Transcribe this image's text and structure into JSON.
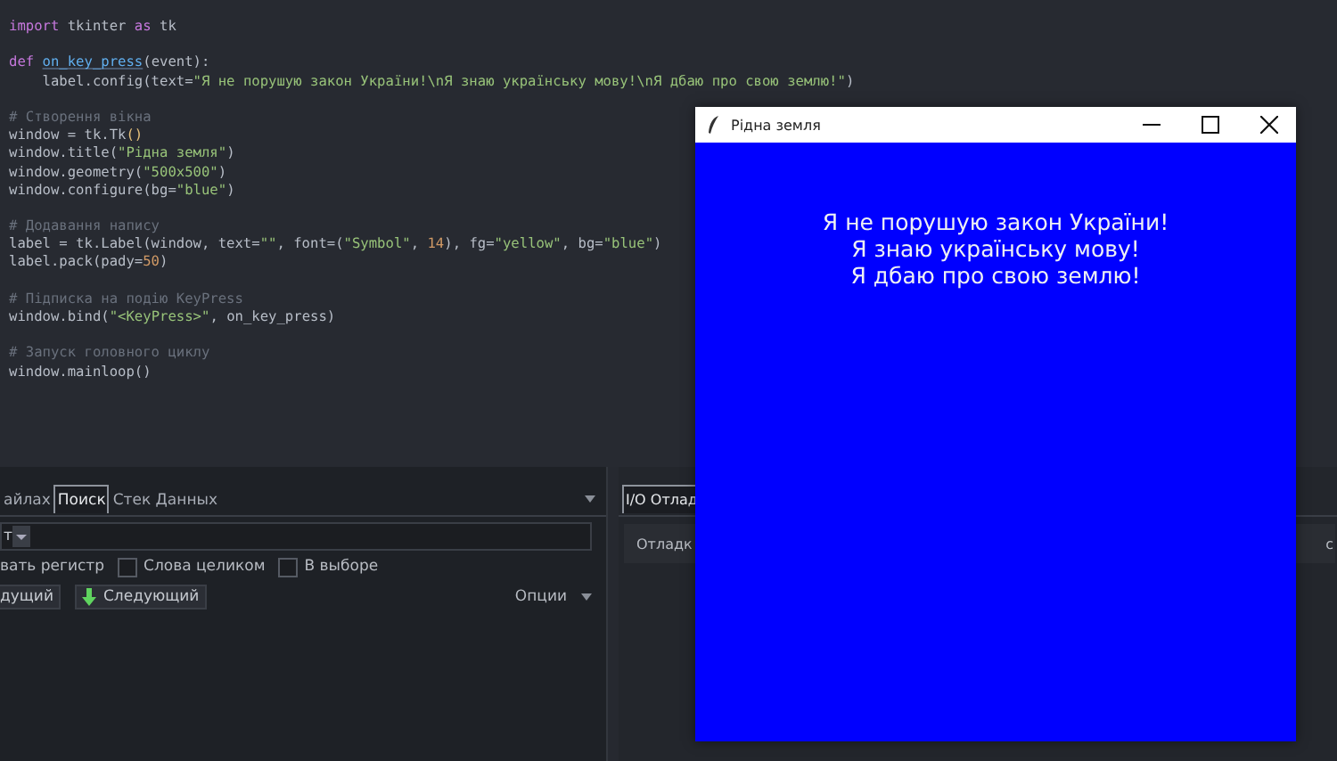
{
  "editor": {
    "lines": [
      {
        "gap_before": false,
        "tokens": [
          {
            "t": "import",
            "kind": "kw"
          },
          {
            "t": " tkinter ",
            "kind": "plain"
          },
          {
            "t": "as",
            "kind": "kw"
          },
          {
            "t": " tk",
            "kind": "plain"
          }
        ]
      },
      {
        "gap_before": true,
        "tokens": [
          {
            "t": "def ",
            "kind": "kw"
          },
          {
            "t": "on_key_press",
            "kind": "func"
          },
          {
            "t": "(event):",
            "kind": "plain"
          }
        ]
      },
      {
        "gap_before": false,
        "tokens": [
          {
            "t": "    label.config(text=",
            "kind": "plain"
          },
          {
            "t": "\"Я не порушую закон України!\\nЯ знаю українську мову!\\nЯ дбаю про свою землю!\"",
            "kind": "str"
          },
          {
            "t": ")",
            "kind": "plain"
          }
        ]
      },
      {
        "gap_before": true,
        "tokens": [
          {
            "t": "# Створення вікна",
            "kind": "comment"
          }
        ]
      },
      {
        "gap_before": false,
        "tokens": [
          {
            "t": "window = tk.Tk",
            "kind": "plain"
          },
          {
            "t": "()",
            "kind": "paren"
          }
        ]
      },
      {
        "gap_before": false,
        "tokens": [
          {
            "t": "window.title(",
            "kind": "plain"
          },
          {
            "t": "\"Рідна земля\"",
            "kind": "str"
          },
          {
            "t": ")",
            "kind": "plain"
          }
        ]
      },
      {
        "gap_before": false,
        "tokens": [
          {
            "t": "window.geometry(",
            "kind": "plain"
          },
          {
            "t": "\"500x500\"",
            "kind": "str"
          },
          {
            "t": ")",
            "kind": "plain"
          }
        ]
      },
      {
        "gap_before": false,
        "tokens": [
          {
            "t": "window.configure(bg=",
            "kind": "plain"
          },
          {
            "t": "\"blue\"",
            "kind": "str"
          },
          {
            "t": ")",
            "kind": "plain"
          }
        ]
      },
      {
        "gap_before": true,
        "tokens": [
          {
            "t": "# Додавання напису",
            "kind": "comment"
          }
        ]
      },
      {
        "gap_before": false,
        "tokens": [
          {
            "t": "label = tk.Label(window, text=",
            "kind": "plain"
          },
          {
            "t": "\"\"",
            "kind": "str"
          },
          {
            "t": ", font=(",
            "kind": "plain"
          },
          {
            "t": "\"Symbol\"",
            "kind": "str"
          },
          {
            "t": ", ",
            "kind": "plain"
          },
          {
            "t": "14",
            "kind": "num"
          },
          {
            "t": "), fg=",
            "kind": "plain"
          },
          {
            "t": "\"yellow\"",
            "kind": "str"
          },
          {
            "t": ", bg=",
            "kind": "plain"
          },
          {
            "t": "\"blue\"",
            "kind": "str"
          },
          {
            "t": ")",
            "kind": "plain"
          }
        ]
      },
      {
        "gap_before": false,
        "tokens": [
          {
            "t": "label.pack(pady=",
            "kind": "plain"
          },
          {
            "t": "50",
            "kind": "num"
          },
          {
            "t": ")",
            "kind": "plain"
          }
        ]
      },
      {
        "gap_before": true,
        "tokens": [
          {
            "t": "# Підписка на подію KeyPress",
            "kind": "comment"
          }
        ]
      },
      {
        "gap_before": false,
        "tokens": [
          {
            "t": "window.bind(",
            "kind": "plain"
          },
          {
            "t": "\"<KeyPress>\"",
            "kind": "str"
          },
          {
            "t": ", on_key_press)",
            "kind": "plain"
          }
        ]
      },
      {
        "gap_before": true,
        "tokens": [
          {
            "t": "# Запуск головного циклу",
            "kind": "comment"
          }
        ]
      },
      {
        "gap_before": false,
        "tokens": [
          {
            "t": "window.mainloop()",
            "kind": "plain"
          }
        ]
      }
    ]
  },
  "search_panel": {
    "tabs": [
      {
        "label": "айлах",
        "selected": false
      },
      {
        "label": "Поиск",
        "selected": true
      },
      {
        "label": "Стек Данных",
        "selected": false
      }
    ],
    "search_field": {
      "value": "т"
    },
    "options": [
      {
        "kind": "label",
        "label": "вать регистр"
      },
      {
        "kind": "checkbox",
        "label": "Слова целиком",
        "checked": false
      },
      {
        "kind": "checkbox",
        "label": "В выборе",
        "checked": false
      }
    ],
    "buttons": [
      {
        "kind": "plain",
        "label": "дущий"
      },
      {
        "kind": "next",
        "label": "Следующий"
      }
    ],
    "options_menu": "Опции"
  },
  "debug_panel": {
    "tabs": [
      {
        "label": "I/O Отлад",
        "selected": true
      }
    ],
    "label": "Отладк",
    "trailing_text": "с"
  },
  "tk_window": {
    "title": "Рідна земля",
    "lines": [
      "Я не порушую закон України!",
      "Я знаю українську мову!",
      "Я дбаю про свою землю!"
    ]
  }
}
